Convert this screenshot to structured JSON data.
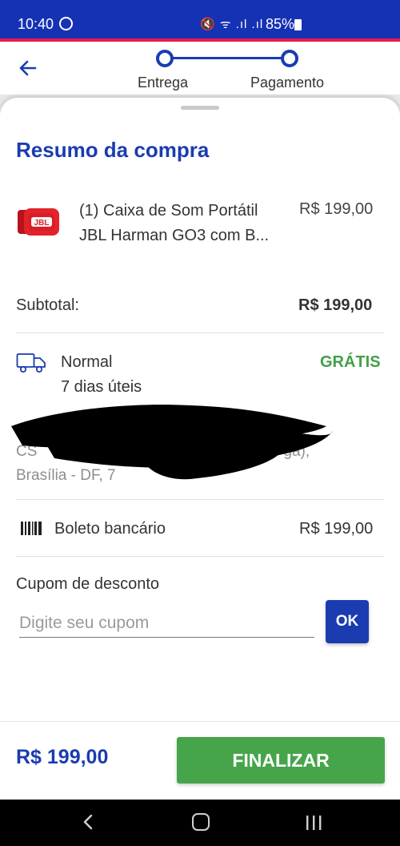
{
  "status_bar": {
    "time": "10:40",
    "icons": "🔇 ᯤ .ıl .ıl",
    "battery": "85%"
  },
  "header": {
    "steps": [
      "Entrega",
      "Pagamento"
    ]
  },
  "summary": {
    "title": "Resumo da compra",
    "product": {
      "name": "(1) Caixa de Som Portátil JBL Harman GO3 com B...",
      "price": "R$ 199,00",
      "image_brand": "JBL"
    },
    "subtotal_label": "Subtotal:",
    "subtotal_value": "R$ 199,00",
    "shipping": {
      "name": "Normal",
      "eta": "7 dias úteis",
      "price": "GRÁTIS"
    },
    "address": {
      "line1": "CS",
      "line1_end": "ga),",
      "line2": "Brasília - DF, 7"
    },
    "payment": {
      "method": "Boleto bancário",
      "value": "R$ 199,00"
    },
    "coupon": {
      "label": "Cupom de desconto",
      "placeholder": "Digite seu cupom",
      "button": "OK"
    }
  },
  "footer": {
    "total": "R$ 199,00",
    "finalize_label": "FINALIZAR"
  },
  "colors": {
    "primary": "#1a3cb0",
    "status_bar": "#1632b4",
    "accent_red": "#e31b4d",
    "success": "#46a54b"
  }
}
